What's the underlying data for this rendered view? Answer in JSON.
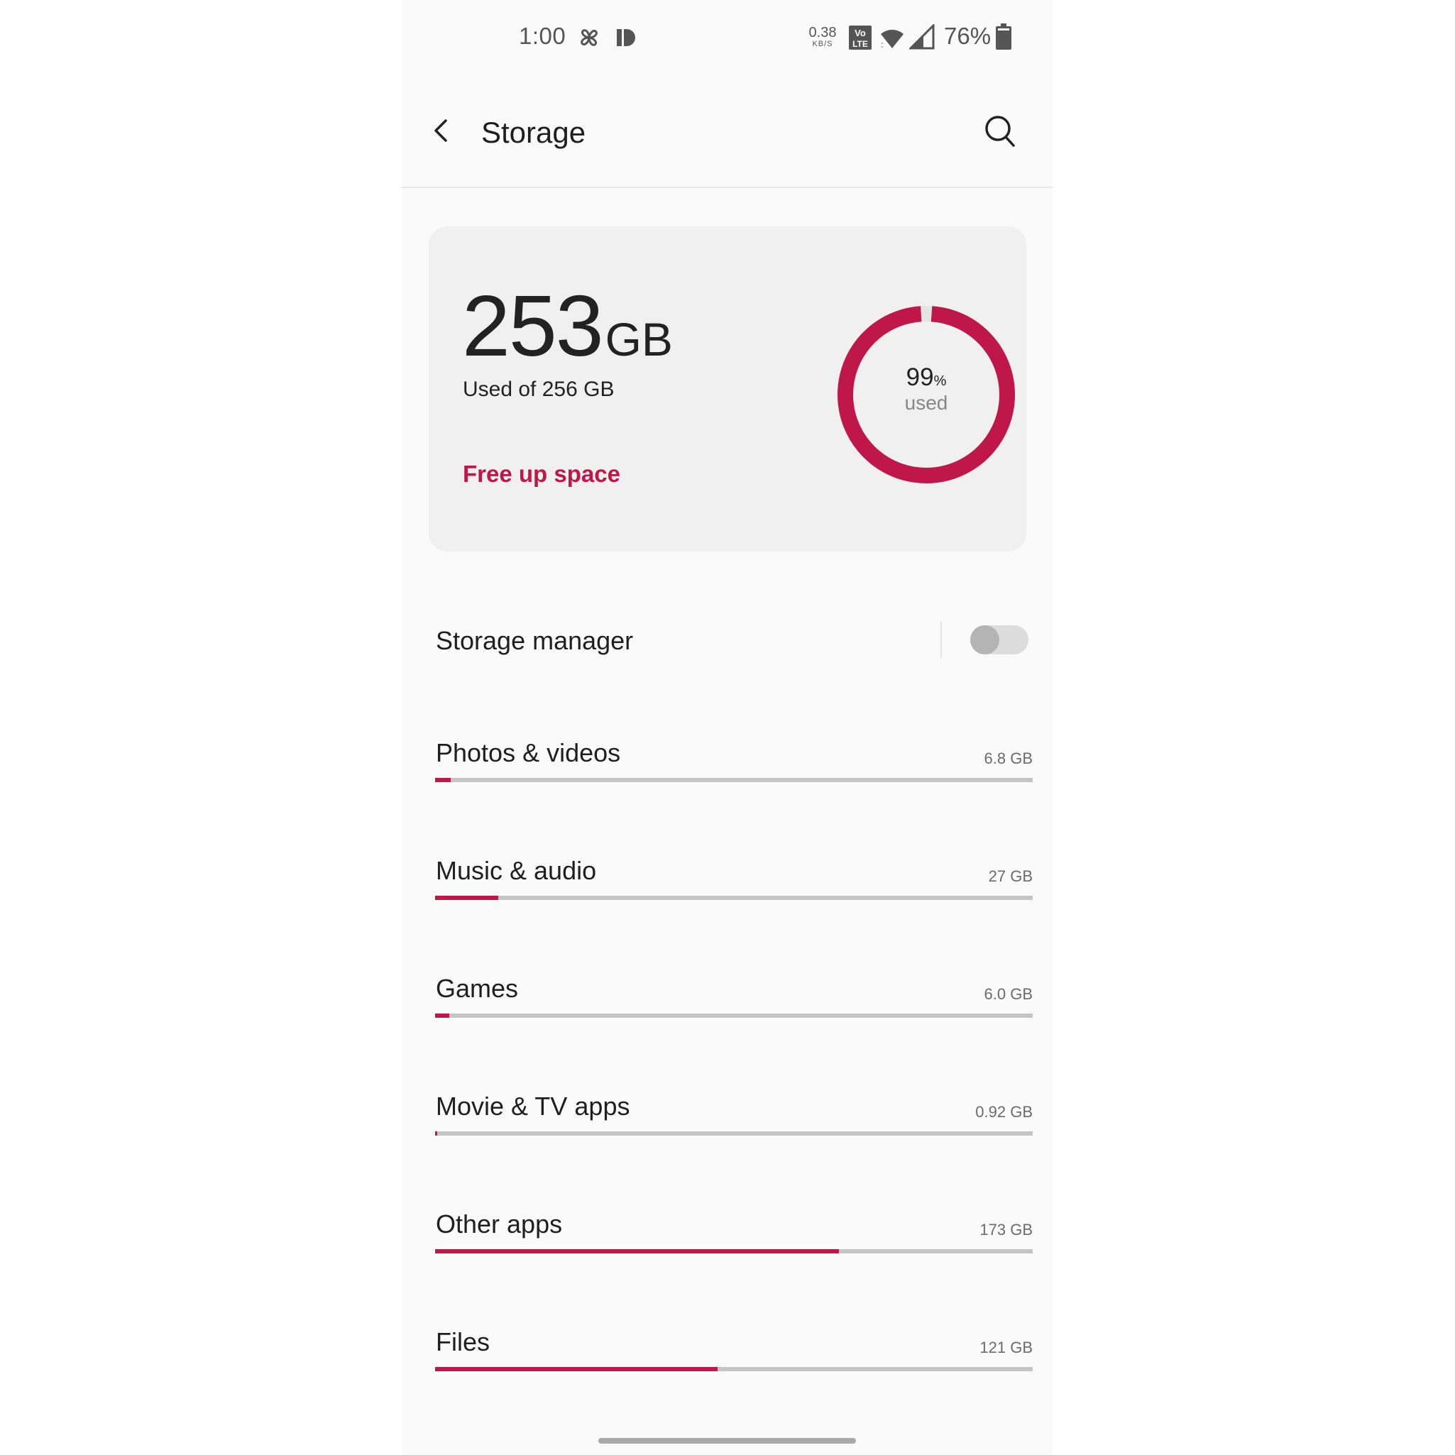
{
  "status_bar": {
    "time": "1:00",
    "left_icons": [
      "pinwheel-icon",
      "id-badge-icon"
    ],
    "net_speed_value": "0.38",
    "net_speed_unit": "KB/S",
    "volte_top": "Vo",
    "volte_bottom": "LTE",
    "battery_percent": "76%"
  },
  "app_bar": {
    "title": "Storage",
    "back_icon": "chevron-left-icon",
    "search_icon": "search-icon"
  },
  "summary": {
    "used_value": "253",
    "used_unit": "GB",
    "used_of_label": "Used of 256 GB",
    "free_up_label": "Free up space",
    "percent_value": "99",
    "percent_sign": "%",
    "percent_caption": "used",
    "used_fraction": 0.99
  },
  "storage_manager": {
    "label": "Storage manager",
    "enabled": false
  },
  "total_gb": 256,
  "categories": [
    {
      "label": "Photos & videos",
      "size": "6.8 GB",
      "gb": 6.8
    },
    {
      "label": "Music & audio",
      "size": "27 GB",
      "gb": 27
    },
    {
      "label": "Games",
      "size": "6.0 GB",
      "gb": 6.0
    },
    {
      "label": "Movie & TV apps",
      "size": "0.92 GB",
      "gb": 0.92
    },
    {
      "label": "Other apps",
      "size": "173 GB",
      "gb": 173
    },
    {
      "label": "Files",
      "size": "121 GB",
      "gb": 121
    }
  ],
  "colors": {
    "accent": "#c0174a",
    "track": "#c4c4c4",
    "card_bg": "#f0f0f0",
    "screen_bg": "#fafafa"
  }
}
